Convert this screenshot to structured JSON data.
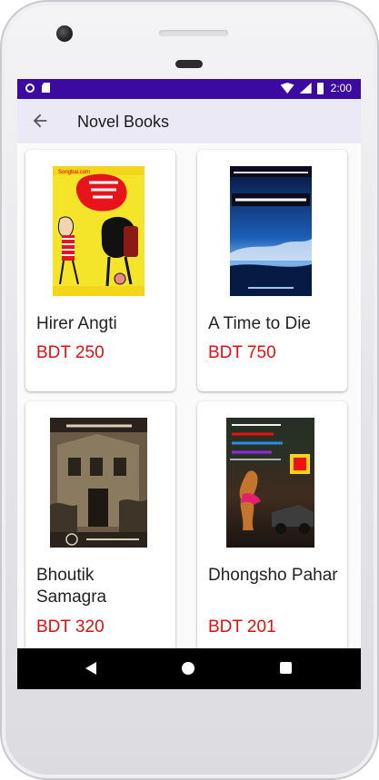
{
  "status_bar": {
    "time": "2:00",
    "icons": [
      "notification-dot-icon",
      "sd-card-icon",
      "wifi-icon",
      "signal-icon",
      "battery-icon"
    ]
  },
  "app_bar": {
    "back_icon": "arrow-left-icon",
    "title": "Novel Books"
  },
  "products": [
    {
      "title": "Hirer Angti",
      "price": "BDT 250",
      "cover_icon": "book-cover-hirer-angti"
    },
    {
      "title": "A Time to Die",
      "price": "BDT 750",
      "cover_icon": "book-cover-a-time-to-die"
    },
    {
      "title": "Bhoutik Samagra",
      "price": "BDT 320",
      "cover_icon": "book-cover-bhoutik-samagra"
    },
    {
      "title": "Dhongsho Pahar",
      "price": "BDT 201",
      "cover_icon": "book-cover-dhongsho-pahar"
    }
  ],
  "nav_bar": {
    "icons": [
      "nav-back-icon",
      "nav-home-icon",
      "nav-recents-icon"
    ]
  },
  "colors": {
    "status_bar": "#3c0aa0",
    "app_bar": "#ece9f7",
    "price": "#e01010"
  }
}
